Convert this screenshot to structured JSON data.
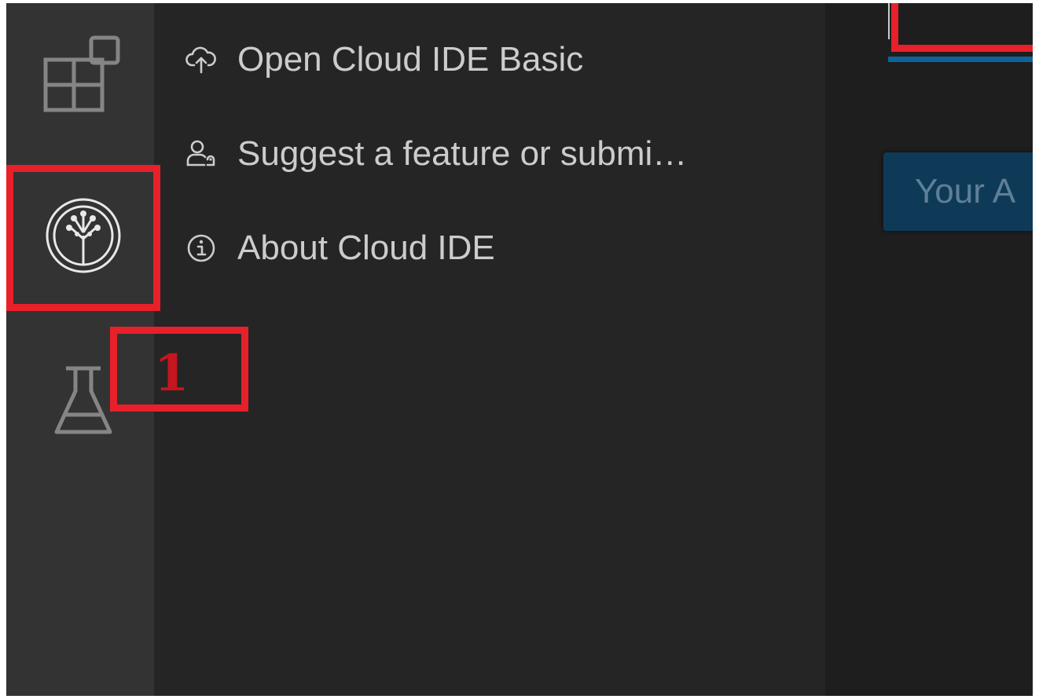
{
  "activity_bar": {
    "icons": [
      "extensions-icon",
      "cloud-ide-tree-icon",
      "testing-flask-icon"
    ]
  },
  "menu": {
    "items": [
      {
        "label": "Open Cloud IDE Basic",
        "icon": "cloud-upload-icon"
      },
      {
        "label": "Suggest a feature or submi…",
        "icon": "person-feedback-icon"
      },
      {
        "label": "About Cloud IDE",
        "icon": "info-icon"
      }
    ]
  },
  "annotation": {
    "number": "1"
  },
  "editor": {
    "button_label": "Your A"
  },
  "colors": {
    "activity_bar": "#333333",
    "sidebar": "#252526",
    "editor": "#1e1e1e",
    "text": "#cccccc",
    "highlight_red": "#e8202a",
    "accent_blue": "#0e639c"
  }
}
